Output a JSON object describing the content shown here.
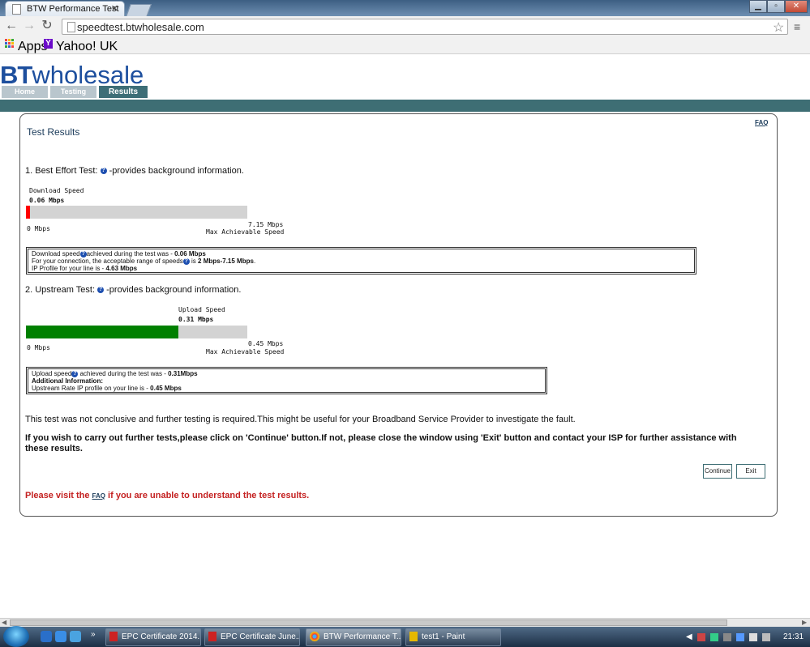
{
  "browser": {
    "tab_title": "BTW Performance Test",
    "url": "speedtest.btwholesale.com",
    "bookmarks": [
      {
        "label": "Apps"
      },
      {
        "label": "Yahoo! UK"
      }
    ]
  },
  "site": {
    "logo_bt": "BT",
    "logo_rest": "wholesale",
    "nav_tabs": [
      "Home",
      "Testing",
      "Results"
    ],
    "active_tab": "Results"
  },
  "page": {
    "title": "Test Results",
    "faq_link": "FAQ",
    "section1": {
      "heading_prefix": "1. Best Effort Test:",
      "heading_suffix": "-provides background information.",
      "bar_label": "Download  Speed",
      "current_value": "0.06 Mbps",
      "min_label": "0 Mbps",
      "max_value": "7.15 Mbps",
      "max_label": "Max Achievable Speed",
      "bar_fill_fraction": 0.008,
      "bar_color": "#ff0000",
      "info": {
        "line1_prefix": "Download speed",
        "line1_mid": "achieved during the test was - ",
        "line1_value": "0.06 Mbps",
        "line2_prefix": "For your connection, the acceptable range of speeds",
        "line2_mid": " is ",
        "line2_value": "2 Mbps-7.15 Mbps",
        "line2_end": ".",
        "line3_prefix": "IP Profile for your line is - ",
        "line3_value": "4.63 Mbps"
      }
    },
    "section2": {
      "heading_prefix": "2. Upstream Test:",
      "heading_suffix": "-provides background information.",
      "bar_label": "Upload Speed",
      "current_value": "0.31 Mbps",
      "min_label": "0 Mbps",
      "max_value": "0.45 Mbps",
      "max_label": "Max Achievable Speed",
      "bar_fill_fraction": 0.689,
      "bar_color": "#008000",
      "info": {
        "line1_prefix": "Upload speed",
        "line1_mid": " achieved during the test was - ",
        "line1_value": "0.31Mbps",
        "line2": "Additional Information:",
        "line3_prefix": "Upstream Rate IP profile on your line is - ",
        "line3_value": "0.45 Mbps"
      }
    },
    "message_inconclusive": "This test was not conclusive and further testing is required.This might be useful for your Broadband Service Provider to investigate the fault.",
    "message_further": "If you wish to carry out further tests,please click on 'Continue' button.If not, please close the window using 'Exit' button and contact your ISP for further assistance with these results.",
    "continue_label": "Continue",
    "exit_label": "Exit",
    "faq_msg_prefix": "Please visit the ",
    "faq_msg_link": "FAQ",
    "faq_msg_suffix": " if you are unable to understand the test results."
  },
  "taskbar": {
    "tasks": [
      {
        "label": "EPC Certificate 2014...",
        "icon": "pdf-icon"
      },
      {
        "label": "EPC Certificate June...",
        "icon": "pdf-icon"
      },
      {
        "label": "BTW Performance T...",
        "icon": "chrome-icon"
      },
      {
        "label": "test1 - Paint",
        "icon": "paint-icon"
      }
    ],
    "clock": "21:31"
  }
}
